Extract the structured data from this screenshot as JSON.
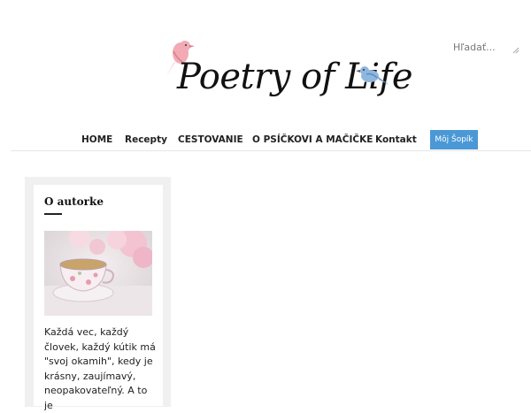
{
  "search": {
    "placeholder": "Hľadať..."
  },
  "logo": {
    "text": "Poetry of Life"
  },
  "nav": {
    "items": [
      "HOME",
      "Recepty",
      "CESTOVANIE",
      "O PSÍČKOVI A MAČIČKE",
      "Kontakt"
    ],
    "button_label": "Môj Šopík"
  },
  "sidebar": {
    "widget_title": "O autorke",
    "text": "Každá vec, každý človek, každý kútik má \"svoj okamih\", kedy je krásny, zaujímavý, neopakovateľný. A to je"
  },
  "colors": {
    "accent": "#4a98d6",
    "sidebar_bg": "#f0f0f0"
  }
}
